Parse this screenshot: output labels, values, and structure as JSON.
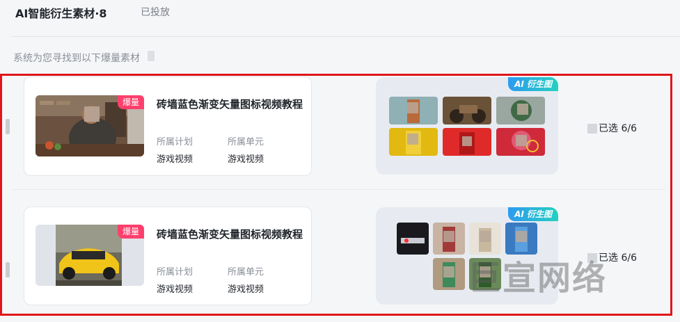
{
  "tabs": {
    "active": "AI智能衍生素材·8",
    "other": "已投放"
  },
  "notice": "系统为您寻找到以下爆量素材",
  "rows": [
    {
      "hot_badge": "爆量",
      "title": "砖墙蓝色渐变矢量图标视频教程",
      "plan_label": "所属计划",
      "plan_value": "游戏视频",
      "unit_label": "所属单元",
      "unit_value": "游戏视频",
      "ai_badge": "AI 衍生图",
      "selected": "已选 6/6"
    },
    {
      "hot_badge": "爆量",
      "title": "砖墙蓝色渐变矢量图标视频教程",
      "plan_label": "所属计划",
      "plan_value": "游戏视频",
      "unit_label": "所属单元",
      "unit_value": "游戏视频",
      "ai_badge": "AI 衍生图",
      "selected": "已选 6/6"
    }
  ],
  "watermark": "巨宣网络",
  "colors": {
    "highlight": "#e0161b",
    "hot": "#ff3f6c",
    "ai_from": "#2d9bf0",
    "ai_to": "#25d0c0"
  }
}
